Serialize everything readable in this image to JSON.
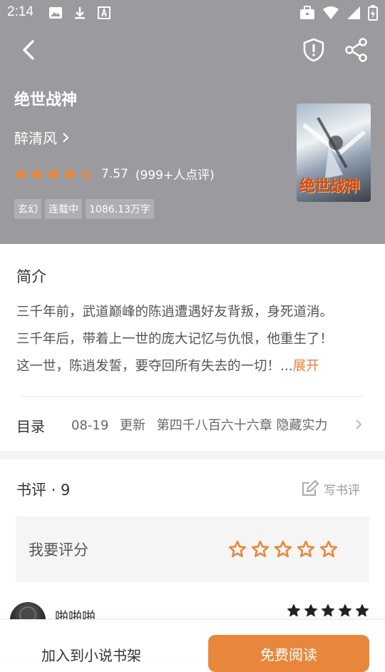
{
  "status_bar": {
    "time": "2:14"
  },
  "book": {
    "title": "绝世战神",
    "author": "醉清风",
    "score": "7.57",
    "rating_count": "(999+人点评)",
    "stars_filled": 4,
    "stars_total": 5,
    "tags": [
      "玄幻",
      "连载中",
      "1086.13万字"
    ],
    "cover_title": "绝世战神"
  },
  "intro": {
    "heading": "简介",
    "lines": [
      "三千年前，武道巅峰的陈逍遭遇好友背叛，身死道消。",
      "三千年后，带着上一世的庞大记忆与仇恨，他重生了！",
      "这一世，陈逍发誓，要夺回所有失去的一切！..."
    ],
    "expand": "展开"
  },
  "toc": {
    "label": "目录",
    "date": "08-19",
    "update": "更新",
    "chapter": "第四千八百六十六章 隐藏实力"
  },
  "reviews": {
    "title": "书评 · 9",
    "write": "写书评",
    "rate_prompt": "我要评分",
    "first_reviewer": "啪啪啪"
  },
  "actions": {
    "add_shelf": "加入到小说书架",
    "read_free": "免费阅读"
  },
  "colors": {
    "header_bg": "#9b9a9f",
    "accent": "#e8873c",
    "star": "#e8873c"
  }
}
